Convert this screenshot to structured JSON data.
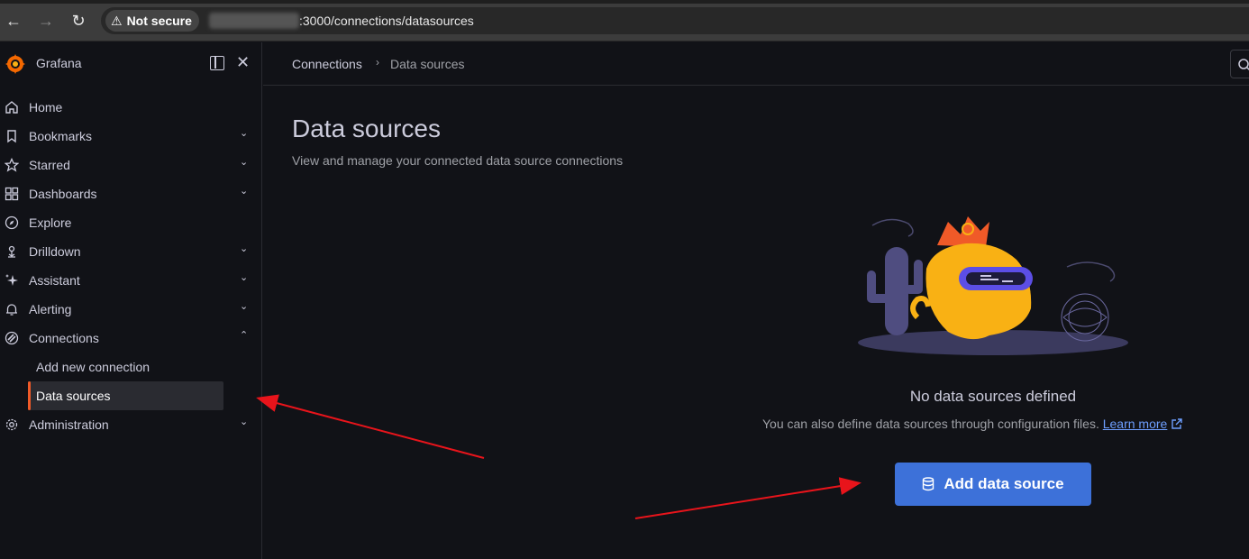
{
  "browser": {
    "security_label": "Not secure",
    "url": ":3000/connections/datasources"
  },
  "sidebar": {
    "brand": "Grafana",
    "items": [
      {
        "label": "Home",
        "icon": "home-icon"
      },
      {
        "label": "Bookmarks",
        "icon": "bookmark-icon"
      },
      {
        "label": "Starred",
        "icon": "star-icon"
      },
      {
        "label": "Dashboards",
        "icon": "dashboards-icon"
      },
      {
        "label": "Explore",
        "icon": "compass-icon"
      },
      {
        "label": "Drilldown",
        "icon": "drilldown-icon"
      },
      {
        "label": "Assistant",
        "icon": "sparkle-icon"
      },
      {
        "label": "Alerting",
        "icon": "bell-icon"
      },
      {
        "label": "Connections",
        "icon": "connections-icon"
      },
      {
        "label": "Administration",
        "icon": "gear-icon"
      }
    ],
    "sub_items": [
      {
        "label": "Add new connection"
      },
      {
        "label": "Data sources"
      }
    ]
  },
  "breadcrumb": {
    "parent": "Connections",
    "current": "Data sources"
  },
  "page": {
    "title": "Data sources",
    "subtitle": "View and manage your connected data source connections"
  },
  "empty_state": {
    "title": "No data sources defined",
    "description": "You can also define data sources through configuration files.",
    "link": "Learn more",
    "button": "Add data source"
  },
  "colors": {
    "accent": "#3d71d9",
    "active_marker": "#f05a28",
    "annotation_arrow": "#e8141b"
  }
}
